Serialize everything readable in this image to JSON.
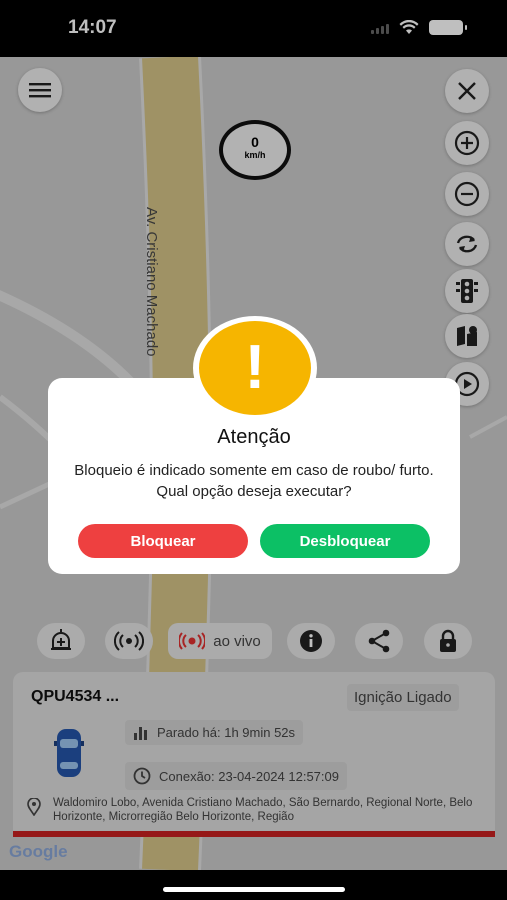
{
  "status_bar": {
    "time": "14:07"
  },
  "map": {
    "street_name": "Av. Cristiano Machado",
    "google_logo": "Google",
    "speed": {
      "value": "0",
      "unit": "km/h"
    },
    "controls": [
      "menu-icon",
      "close-icon",
      "zoom-in-icon",
      "zoom-out-icon",
      "refresh-icon",
      "traffic-light-icon",
      "map-layers-icon",
      "play-icon"
    ]
  },
  "dialog": {
    "icon": "!",
    "title": "Atenção",
    "message": "Bloqueio é indicado somente em caso de roubo/ furto. Qual opção deseja executar?",
    "block_label": "Bloquear",
    "unblock_label": "Desbloquear",
    "colors": {
      "block": "#ee4040",
      "unblock": "#0cc065",
      "icon": "#f6b500"
    }
  },
  "actions": {
    "live_label": "ao vivo",
    "icons": [
      "alarm-add-icon",
      "broadcast-icon",
      "live-icon",
      "info-icon",
      "share-icon",
      "lock-icon"
    ]
  },
  "vehicle": {
    "plate": "QPU4534 ...",
    "ignition": "Ignição Ligado",
    "stopped": "Parado há: 1h 9min 52s",
    "connection": "Conexão: 23-04-2024 12:57:09",
    "address": "Waldomiro Lobo, Avenida Cristiano Machado, São Bernardo, Regional Norte, Belo Horizonte, Microrregião Belo Horizonte, Região"
  }
}
